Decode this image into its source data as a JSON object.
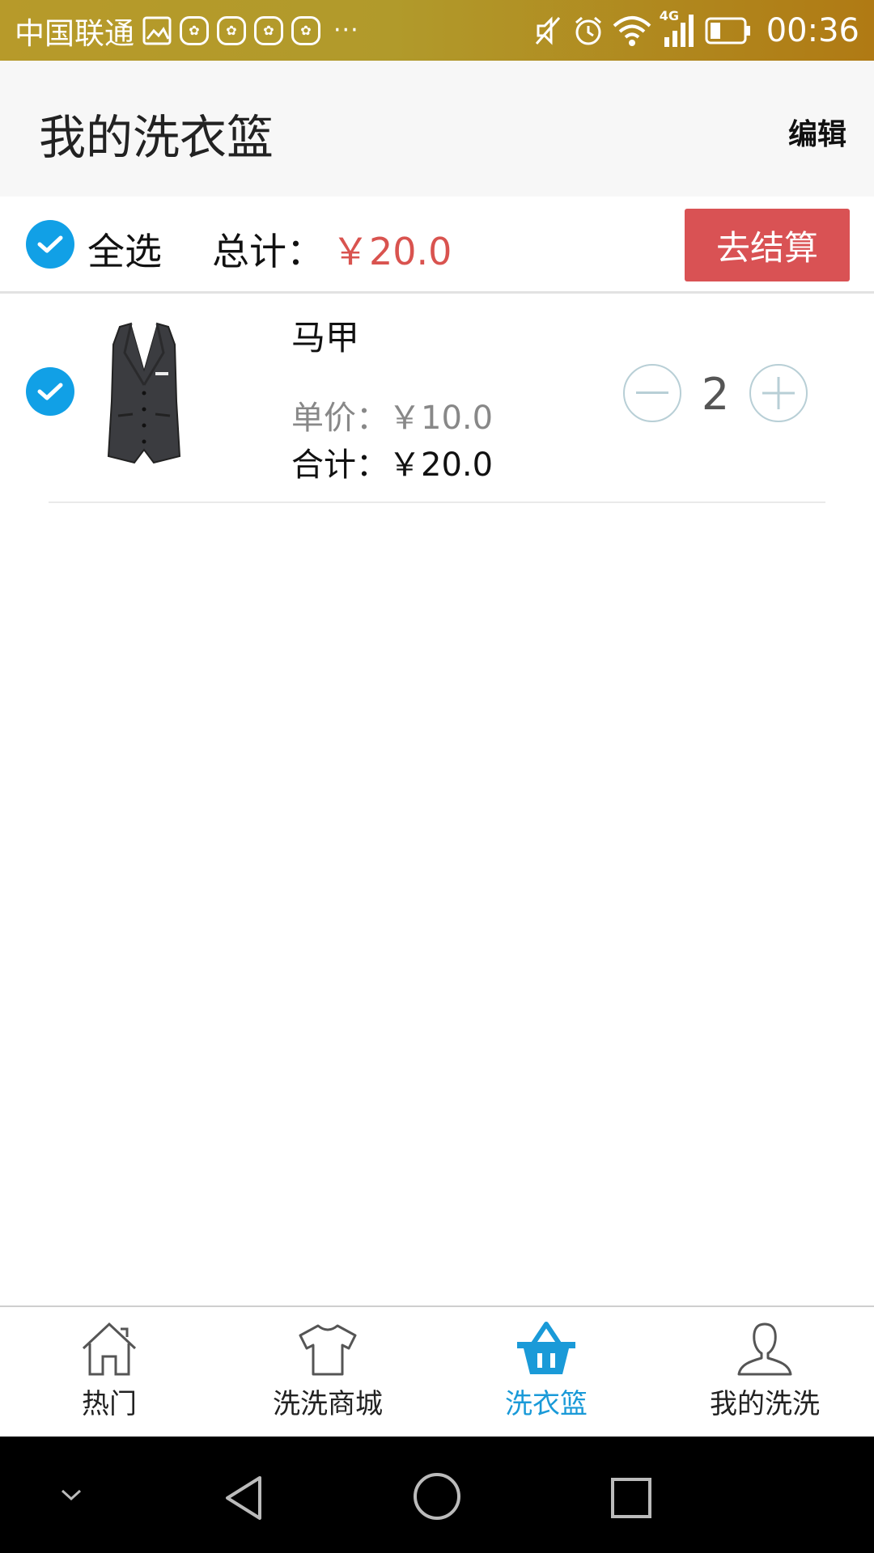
{
  "status_bar": {
    "carrier": "中国联通",
    "icons": [
      "gallery-icon",
      "huawei-app-icon",
      "huawei-app-icon",
      "huawei-app-icon",
      "huawei-app-icon",
      "more-dots-icon",
      "mute-icon",
      "alarm-icon",
      "wifi-icon",
      "4g-signal-icon",
      "battery-icon"
    ],
    "more": "···",
    "network": "4G",
    "time": "00:36"
  },
  "header": {
    "title": "我的洗衣篮",
    "edit_label": "编辑"
  },
  "summary": {
    "select_all_label": "全选",
    "total_label": "总计：",
    "total_value": "￥20.0",
    "checkout_label": "去结算"
  },
  "items": [
    {
      "name": "马甲",
      "unit_price": "单价：￥10.0",
      "subtotal": "合计：￥20.0",
      "quantity": "2",
      "checked": true,
      "image_icon": "vest-image"
    }
  ],
  "bottom_nav": {
    "items": [
      {
        "label": "热门",
        "icon": "home-icon",
        "active": false
      },
      {
        "label": "洗洗商城",
        "icon": "tshirt-icon",
        "active": false
      },
      {
        "label": "洗衣篮",
        "icon": "basket-icon",
        "active": true
      },
      {
        "label": "我的洗洗",
        "icon": "user-icon",
        "active": false
      }
    ]
  },
  "system_nav": {
    "icons": [
      "collapse-icon",
      "back-icon",
      "home-circle-icon",
      "recents-icon"
    ]
  },
  "colors": {
    "accent_blue": "#11a0e6",
    "price_red": "#d9534f",
    "checkout_red": "#d95254",
    "active_nav": "#1a9ad8"
  }
}
